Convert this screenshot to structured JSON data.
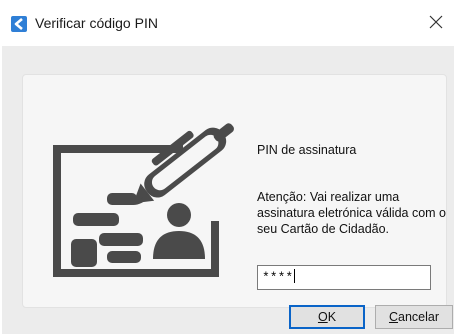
{
  "window": {
    "title": "Verificar código PIN",
    "icon": "app-logo-icon",
    "close_icon": "close-icon"
  },
  "dialog": {
    "pin_label": "PIN de assinatura",
    "warning_text": "Atenção: Vai realizar uma assinatura eletrónica válida com o seu Cartão de Cidadão.",
    "pin_value": "****",
    "ok_button": {
      "mnemonic": "O",
      "rest": "K"
    },
    "cancel_button": {
      "mnemonic": "C",
      "rest": "ancelar"
    }
  },
  "colors": {
    "accent": "#0a64c8",
    "icon_gray": "#4a4a4a"
  }
}
